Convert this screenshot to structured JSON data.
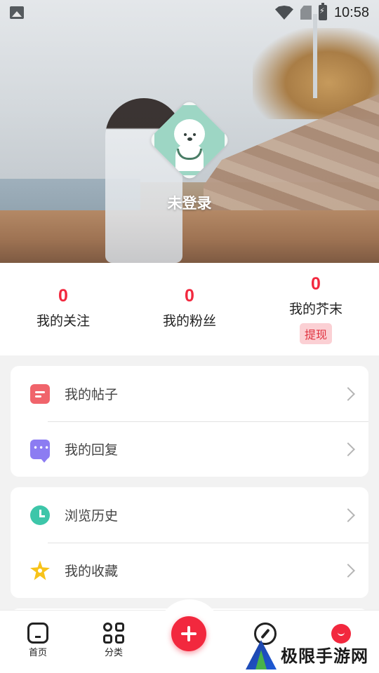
{
  "status_bar": {
    "time": "10:58",
    "icons": [
      "gallery-icon",
      "wifi-icon",
      "no-sim-icon",
      "battery-charging-icon"
    ]
  },
  "profile": {
    "login_text": "未登录",
    "avatar_icon": "dog-avatar-icon"
  },
  "stats": [
    {
      "value": "0",
      "label": "我的关注"
    },
    {
      "value": "0",
      "label": "我的粉丝"
    },
    {
      "value": "0",
      "label": "我的芥末",
      "action": "提现"
    }
  ],
  "menu_groups": [
    [
      {
        "label": "我的帖子",
        "icon": "post-icon"
      },
      {
        "label": "我的回复",
        "icon": "reply-icon"
      }
    ],
    [
      {
        "label": "浏览历史",
        "icon": "history-clock-icon"
      },
      {
        "label": "我的收藏",
        "icon": "favorite-star-icon"
      }
    ]
  ],
  "bottom_nav": {
    "items": [
      {
        "label": "首页",
        "icon": "home-icon"
      },
      {
        "label": "分类",
        "icon": "category-grid-icon"
      },
      {
        "label": "",
        "icon": "add-icon"
      },
      {
        "label": "",
        "icon": "compass-icon"
      },
      {
        "label": "",
        "icon": "me-icon"
      }
    ]
  },
  "watermark": {
    "text": "极限手游网"
  },
  "colors": {
    "accent": "#f2283e",
    "withdraw_bg": "#fbd0d4",
    "page_bg": "#f2f2f2",
    "card_bg": "#ffffff"
  }
}
